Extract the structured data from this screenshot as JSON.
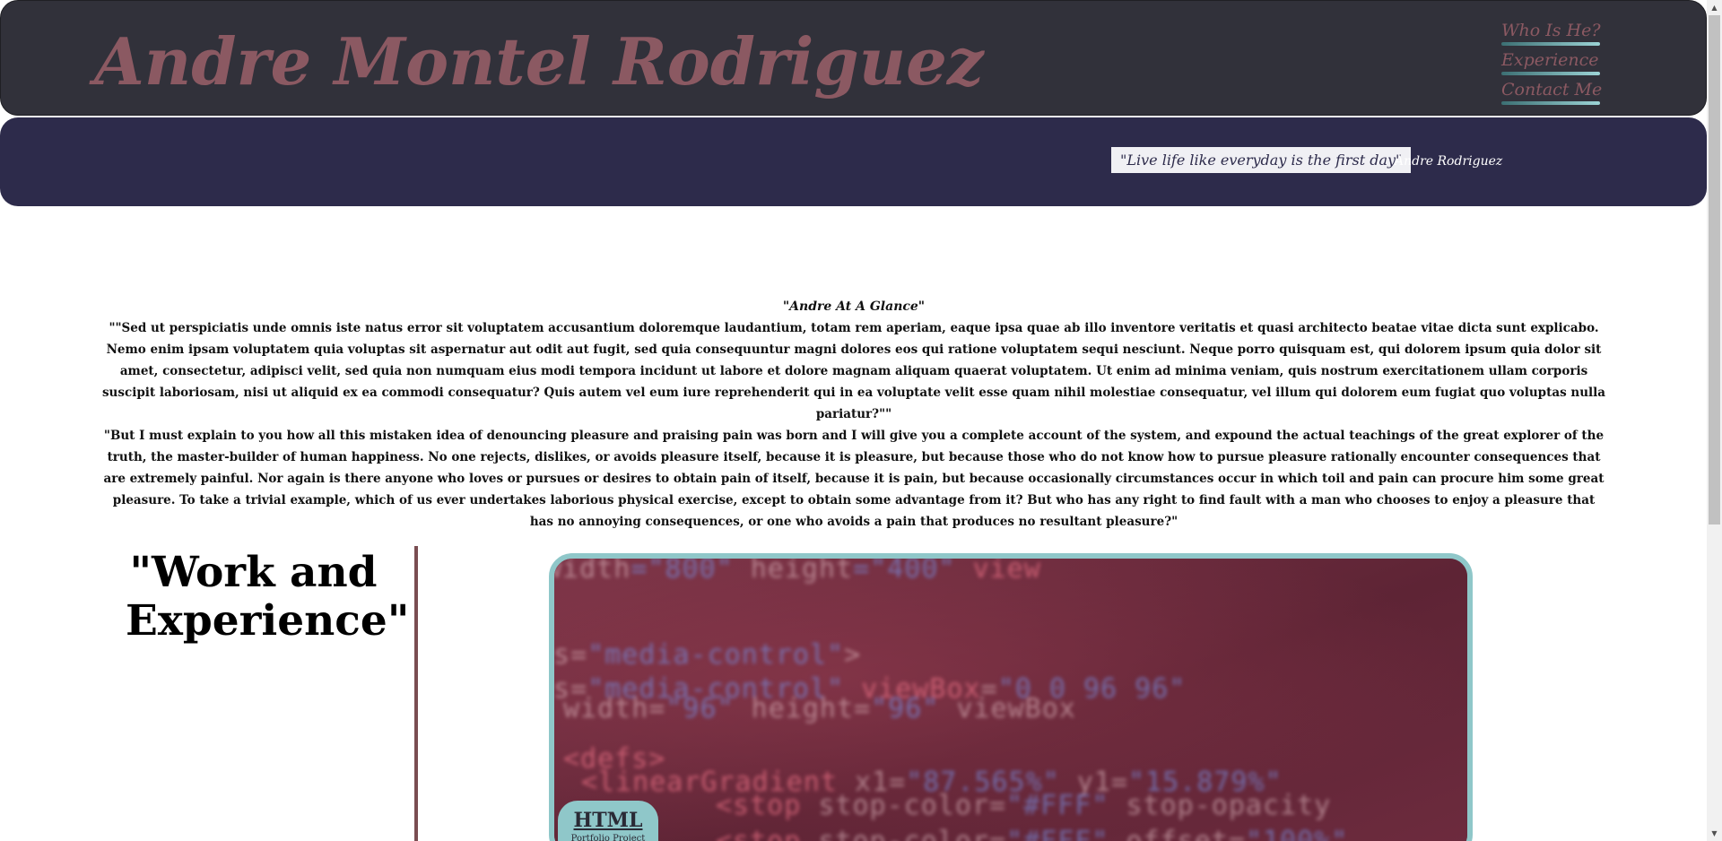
{
  "header": {
    "site_title": "Andre Montel Rodriguez",
    "nav": [
      {
        "label": "Who Is He?"
      },
      {
        "label": "Experience"
      },
      {
        "label": "Contact Me"
      }
    ]
  },
  "quote": {
    "text": "\"Live life like everyday is the first day\"",
    "author": "Andre Rodriguez"
  },
  "glance": {
    "title": "\"Andre At A Glance\"",
    "paragraph_1": "\"\"Sed ut perspiciatis unde omnis iste natus error sit voluptatem accusantium doloremque laudantium, totam rem aperiam, eaque ipsa quae ab illo inventore veritatis et quasi architecto beatae vitae dicta sunt explicabo. Nemo enim ipsam voluptatem quia voluptas sit aspernatur aut odit aut fugit, sed quia consequuntur magni dolores eos qui ratione voluptatem sequi nesciunt. Neque porro quisquam est, qui dolorem ipsum quia dolor sit amet, consectetur, adipisci velit, sed quia non numquam eius modi tempora incidunt ut labore et dolore magnam aliquam quaerat voluptatem. Ut enim ad minima veniam, quis nostrum exercitationem ullam corporis suscipit laboriosam, nisi ut aliquid ex ea commodi consequatur? Quis autem vel eum iure reprehenderit qui in ea voluptate velit esse quam nihil molestiae consequatur, vel illum qui dolorem eum fugiat quo voluptas nulla pariatur?\"\"",
    "paragraph_2": "\"But I must explain to you how all this mistaken idea of denouncing pleasure and praising pain was born and I will give you a complete account of the system, and expound the actual teachings of the great explorer of the truth, the master-builder of human happiness. No one rejects, dislikes, or avoids pleasure itself, because it is pleasure, but because those who do not know how to pursue pleasure rationally encounter consequences that are extremely painful. Nor again is there anyone who loves or pursues or desires to obtain pain of itself, because it is pain, but because occasionally circumstances occur in which toil and pain can procure him some great pleasure. To take a trivial example, which of us ever undertakes laborious physical exercise, except to obtain some advantage from it? But who has any right to find fault with a man who chooses to enjoy a pleasure that has no annoying consequences, or one who avoids a pain that produces no resultant pleasure?\""
  },
  "work": {
    "heading": "\"Work and Experience\"",
    "project": {
      "title": "HTML",
      "subtitle": "Portfolio Project"
    }
  },
  "colors": {
    "header_bg": "#31313a",
    "title_color": "#8b5962",
    "quote_band_bg": "#2d2b4b",
    "accent_teal": "#8fc7c9",
    "divider": "#7a4d52"
  }
}
